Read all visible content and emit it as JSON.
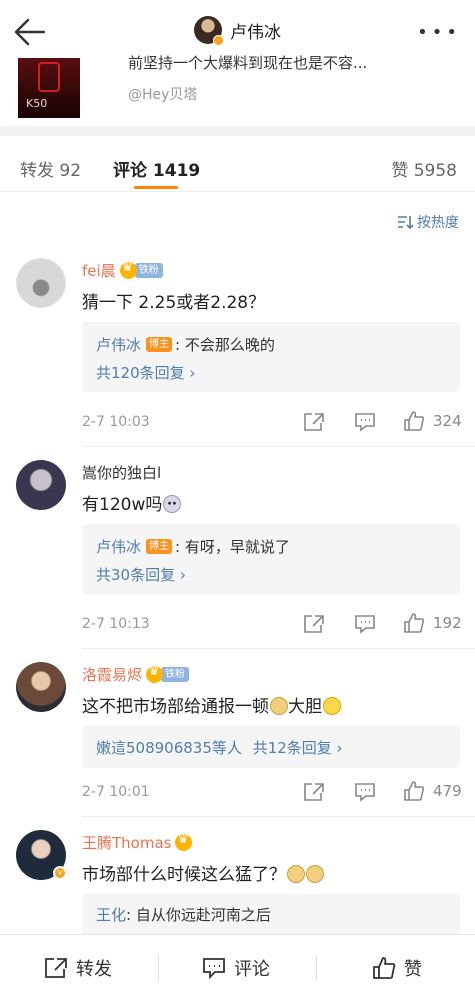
{
  "header": {
    "title": "卢伟冰",
    "back_icon": "arrow-left-icon",
    "more_icon": "more-dots-icon"
  },
  "post_ref": {
    "text": "前坚持一个大爆料到现在也是不容...",
    "source": "@Hey贝塔",
    "thumb_label": "K50"
  },
  "tabs": {
    "repost": "转发 92",
    "comment": "评论 1419",
    "like": "赞 5958"
  },
  "sort": {
    "label": "按热度",
    "icon": "sort-icon"
  },
  "comments": [
    {
      "name": "fei晨",
      "badge": "铁粉",
      "text": "猜一下 2.25或者2.28？",
      "reply_name": "卢伟冰",
      "reply_badge": "博主",
      "reply_text": ": 不会那么晚的",
      "reply_more": "共120条回复 ›",
      "time": "2-7 10:03",
      "likes": "324"
    },
    {
      "name": "嵩你的独白l",
      "text": "有120w吗",
      "reply_name": "卢伟冰",
      "reply_badge": "博主",
      "reply_text": ": 有呀，早就说了",
      "reply_more": "共30条回复 ›",
      "time": "2-7 10:13",
      "likes": "192"
    },
    {
      "name": "洛霞易烬",
      "badge": "铁粉",
      "text": "这不把市场部给通报一顿",
      "text_tail": "大胆",
      "reply_more_name": "嫩這508906835等人",
      "reply_more": "共12条回复 ›",
      "time": "2-7 10:01",
      "likes": "479"
    },
    {
      "name": "王腾Thomas",
      "text": "市场部什么时候这么猛了？",
      "reply_name": "王化",
      "reply_text": ": 自从你远赴河南之后"
    }
  ],
  "bottom": {
    "repost": "转发",
    "comment": "评论",
    "like": "赞"
  },
  "colors": {
    "accent": "#ff8200",
    "link": "#507daf",
    "name_orange": "#eb7350"
  }
}
